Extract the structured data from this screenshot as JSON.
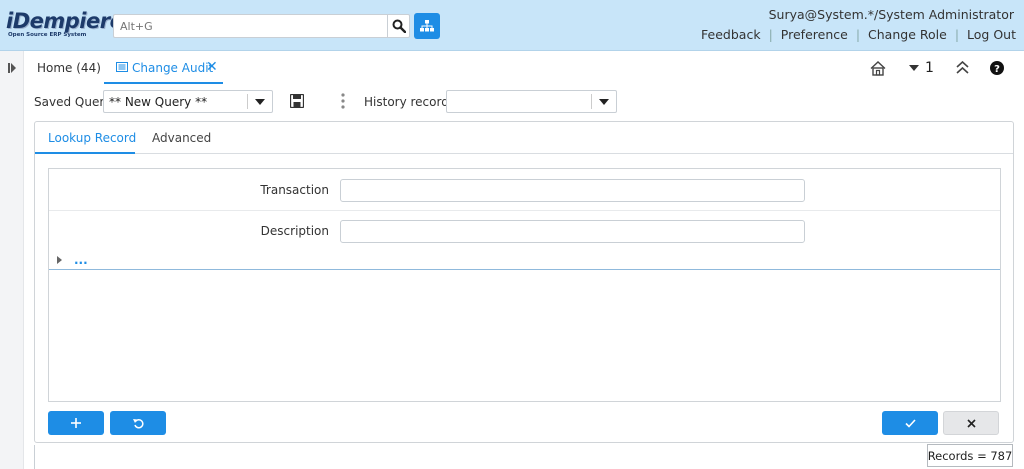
{
  "header": {
    "logo_main": "iDempiere",
    "logo_sub": "Open Source ERP System",
    "search_placeholder": "Alt+G",
    "user": "Surya@System.*/System Administrator",
    "links": [
      "Feedback",
      "Preference",
      "Change Role",
      "Log Out"
    ]
  },
  "tabs": {
    "home": "Home (44)",
    "active": "Change Audit",
    "window_count": "1"
  },
  "query_bar": {
    "saved_query_label": "Saved Query",
    "saved_query_value": "** New Query **",
    "history_label": "History records",
    "history_value": ""
  },
  "panel": {
    "subtabs": [
      "Lookup Record",
      "Advanced"
    ],
    "fields": [
      {
        "label": "Transaction",
        "value": ""
      },
      {
        "label": "Description",
        "value": ""
      }
    ],
    "more": "..."
  },
  "footer": {
    "records": "Records = 787"
  },
  "colors": {
    "accent": "#1e8de5",
    "header_bg": "#c8e5f9"
  }
}
